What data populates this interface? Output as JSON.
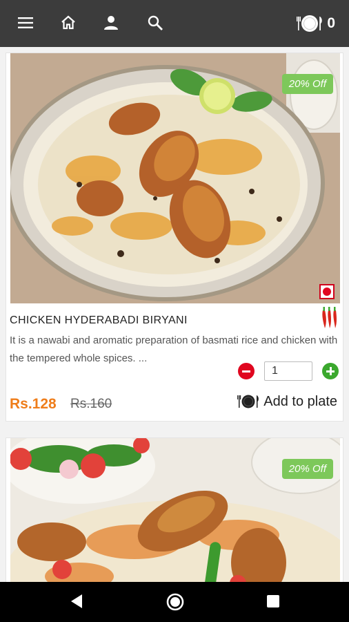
{
  "header": {
    "menu_icon": "hamburger-icon",
    "home_icon": "home-icon",
    "profile_icon": "user-icon",
    "search_icon": "search-icon",
    "plate_icon": "plate-icon",
    "plate_count": "0"
  },
  "items": [
    {
      "discount": "20% Off",
      "title": "CHICKEN HYDERABADI BIRYANI",
      "description": "It is a nawabi and aromatic preparation of basmati rice and chicken with the tempered whole spices. ...",
      "quantity": "1",
      "price": "Rs.128",
      "old_price": "Rs.160",
      "add_label": "Add to plate",
      "veg_marker": "non-veg-indicator",
      "spice_icon": "chili-icon"
    },
    {
      "discount": "20% Off"
    }
  ],
  "system_nav": {
    "back_icon": "back-icon",
    "home_icon": "home-circle-icon",
    "recents_icon": "recents-icon"
  },
  "colors": {
    "topbar": "#3c3c3c",
    "accent_price": "#ef7d1a",
    "discount_badge": "#7dc85a",
    "minus": "#e0061f",
    "plus": "#3ba82e"
  }
}
